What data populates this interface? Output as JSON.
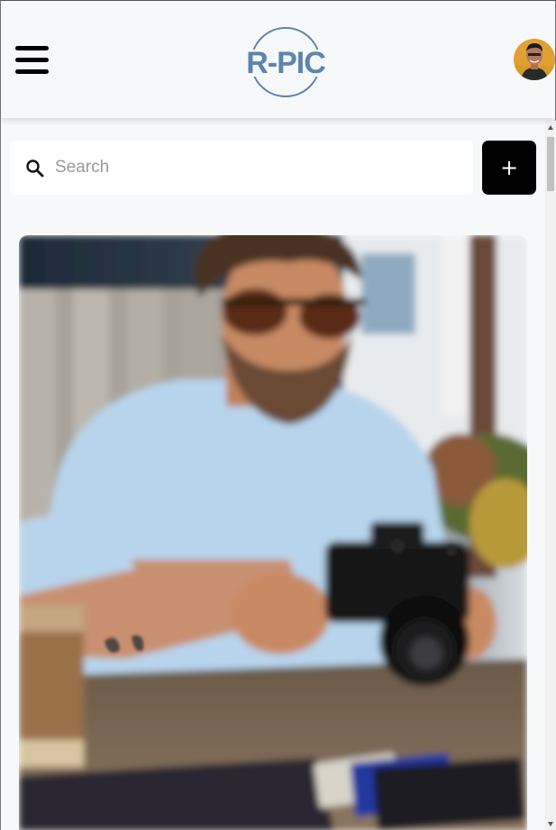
{
  "header": {
    "logo_text": "R-PIC",
    "menu_icon": "hamburger-menu-icon",
    "avatar_icon": "user-avatar"
  },
  "search": {
    "placeholder": "Search",
    "value": "",
    "icon": "search-icon"
  },
  "add_button": {
    "label": "+"
  },
  "colors": {
    "background": "#f7f8fa",
    "logo": "#5b86ad",
    "add_button": "#000000"
  },
  "feed": {
    "items": [
      {
        "type": "photo",
        "subject": "man-with-camera"
      }
    ]
  }
}
